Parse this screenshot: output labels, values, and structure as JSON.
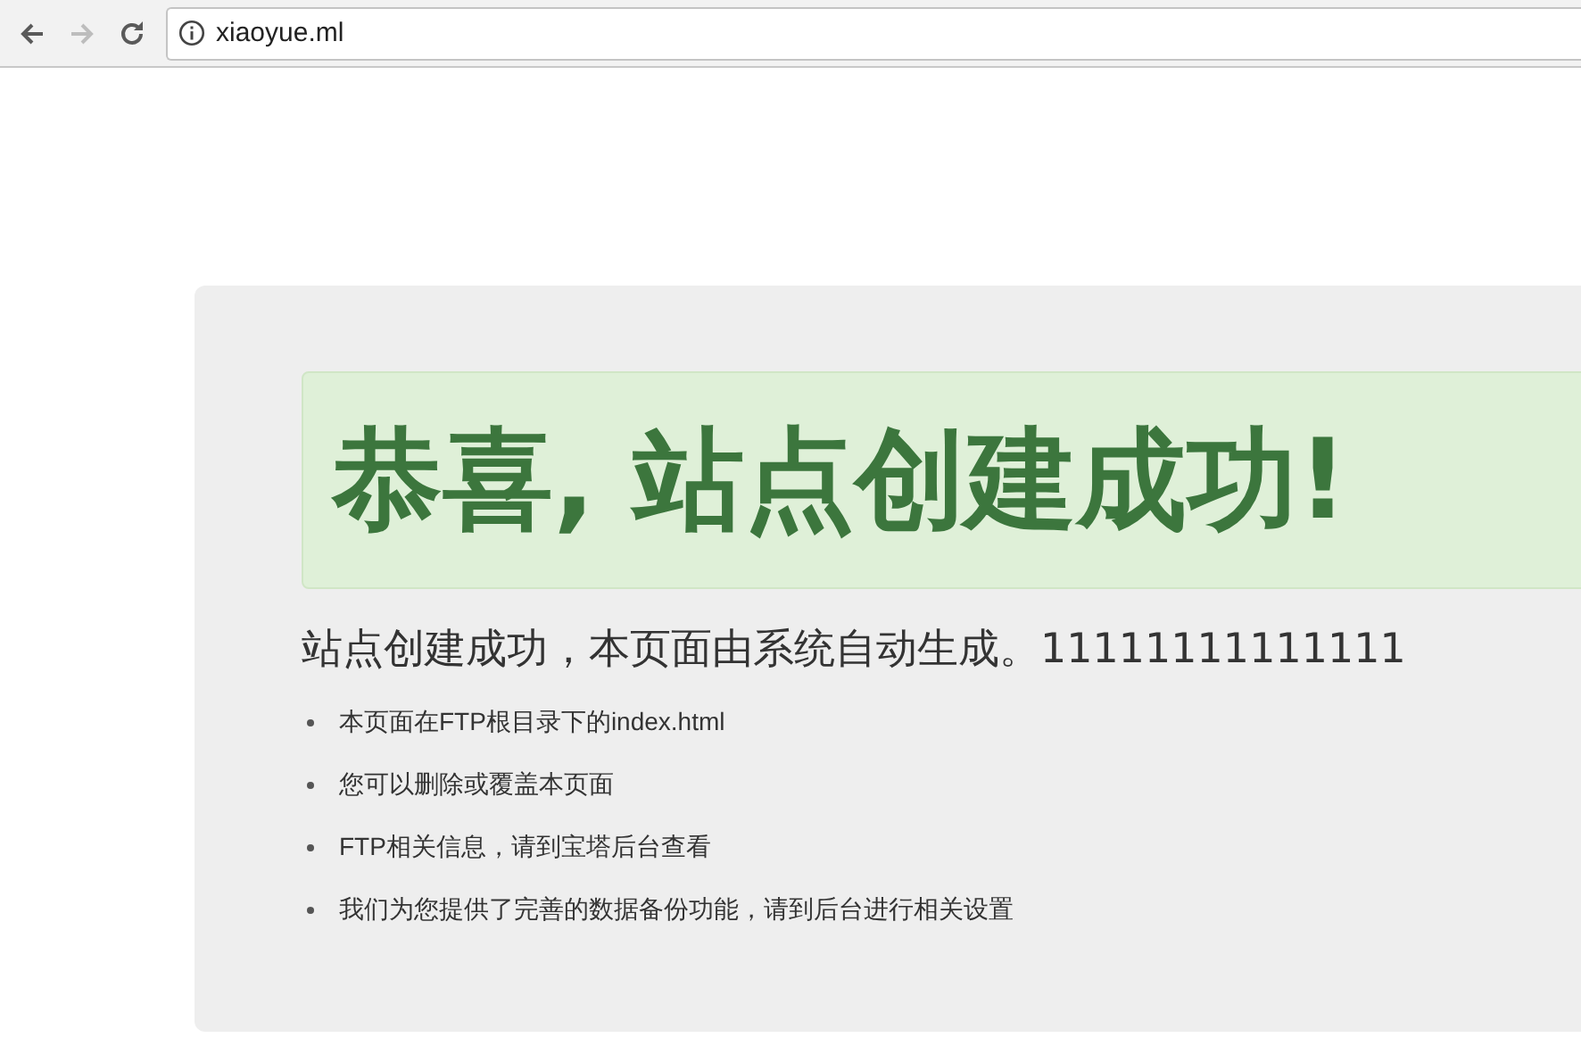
{
  "browser": {
    "address": "xiaoyue.ml",
    "back_disabled": false,
    "forward_disabled": true
  },
  "page": {
    "banner": "恭喜, 站点创建成功!",
    "heading": "站点创建成功，本页面由系统自动生成。11111111111111",
    "items": [
      "本页面在FTP根目录下的index.html",
      "您可以删除或覆盖本页面",
      "FTP相关信息，请到宝塔后台查看",
      "我们为您提供了完善的数据备份功能，请到后台进行相关设置"
    ]
  }
}
